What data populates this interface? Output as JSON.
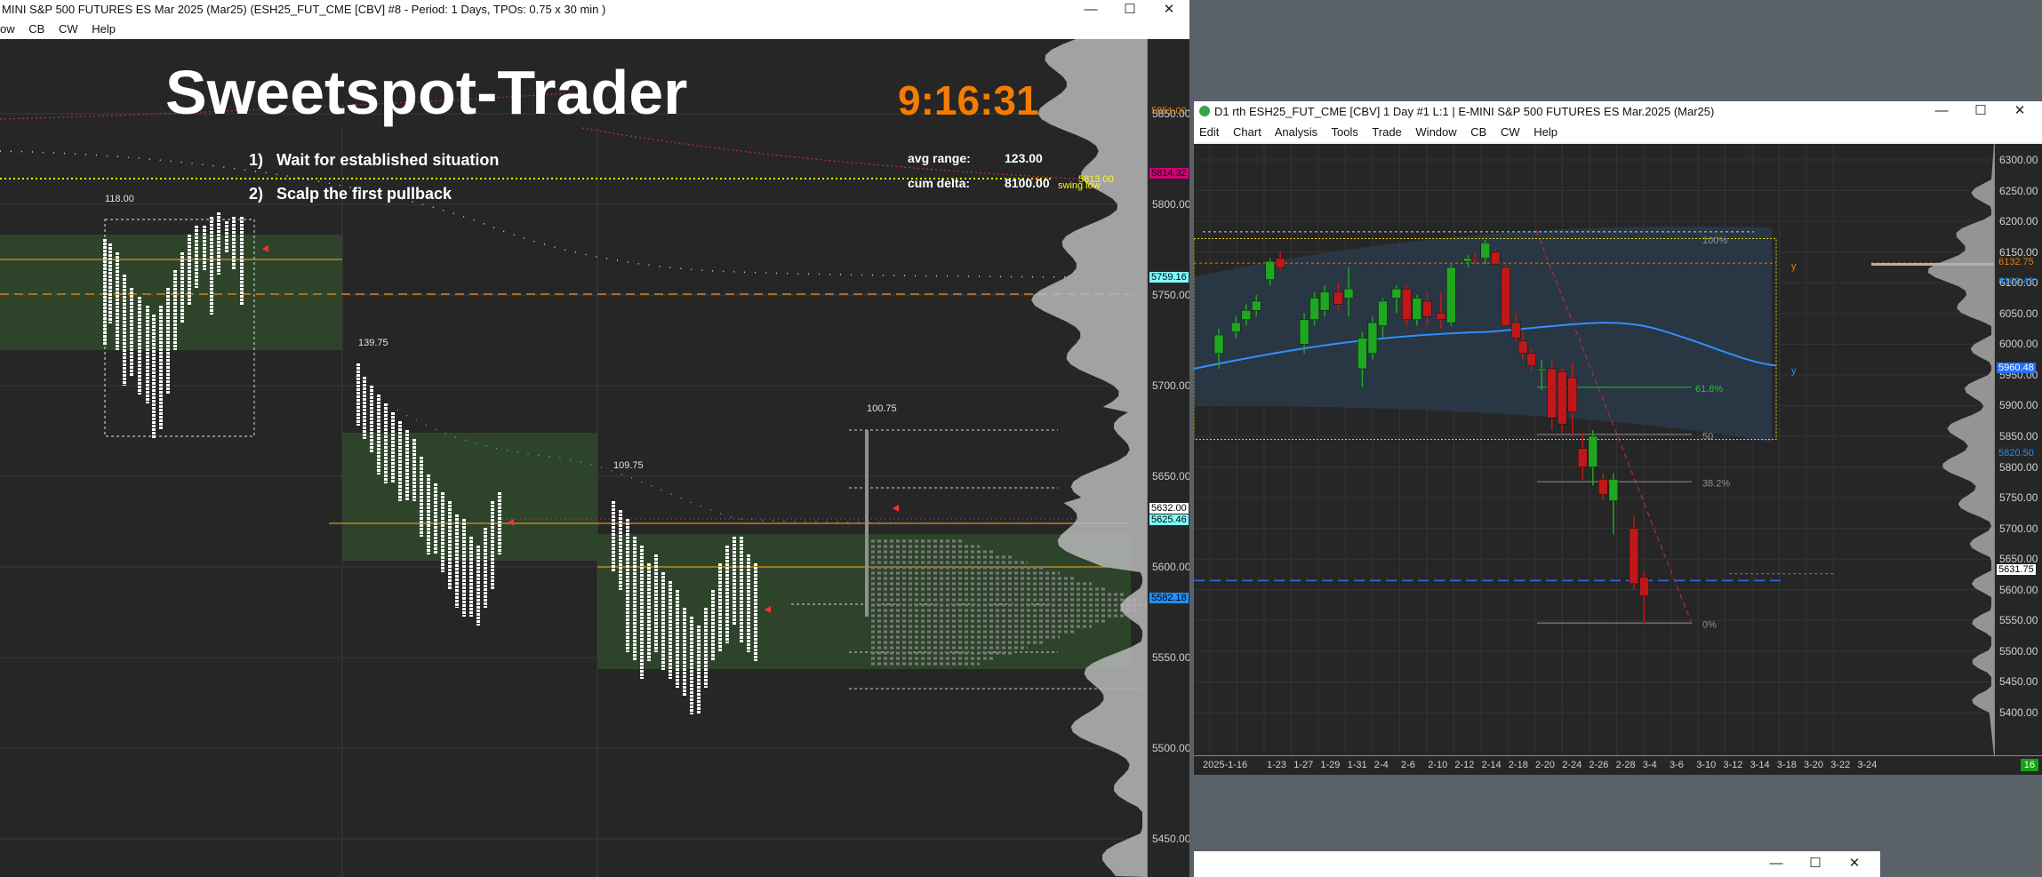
{
  "left_window": {
    "title": "MINI S&P 500 FUTURES ES Mar 2025 (Mar25) (ESH25_FUT_CME [CBV] #8 - Period: 1 Days, TPOs: 0.75 x 30 min  )",
    "menu": [
      "ow",
      "CB",
      "CW",
      "Help"
    ],
    "brand": "Sweetspot-Trader",
    "clock": "9:16:31",
    "rules": [
      "1)   Wait for established situation",
      "2)   Scalp the first pullback"
    ],
    "stats": {
      "avg_range_label": "avg range:",
      "avg_range_value": "123.00",
      "cum_delta_label": "cum delta:",
      "cum_delta_value": "8100.00"
    },
    "range_labels": [
      "118.00",
      "139.75",
      "109.75",
      "100.75"
    ],
    "swing_low": "swing low",
    "price_axis": [
      "5850.00",
      "5800.00",
      "5750.00",
      "5700.00",
      "5650.00",
      "5600.00",
      "5550.00",
      "5500.00",
      "5450.00"
    ],
    "price_tags": [
      {
        "text": "5851.00",
        "color": "#f07800"
      },
      {
        "text": "5813.00",
        "color": "#ffff00"
      },
      {
        "text": "5814.32",
        "color": "#d6007a"
      },
      {
        "text": "5759.16",
        "color": "#80ffff"
      },
      {
        "text": "5632.00",
        "color": "#ffffff"
      },
      {
        "text": "5625.46",
        "color": "#80ffff"
      },
      {
        "text": "5582.18",
        "color": "#1e90ff"
      }
    ]
  },
  "right_window": {
    "title": "D1 rth ESH25_FUT_CME [CBV]  1 Day  #1 L:1 | E-MINI S&P 500 FUTURES ES Mar.2025 (Mar25)",
    "menu": [
      "Edit",
      "Chart",
      "Analysis",
      "Tools",
      "Trade",
      "Window",
      "CB",
      "CW",
      "Help"
    ],
    "price_axis": [
      "6300.00",
      "6250.00",
      "6200.00",
      "6150.00",
      "6100.00",
      "6050.00",
      "6000.00",
      "5950.00",
      "5900.00",
      "5850.00",
      "5800.00",
      "5750.00",
      "5700.00",
      "5650.00",
      "5600.00",
      "5550.00",
      "5500.00",
      "5450.00",
      "5400.00"
    ],
    "price_tags": [
      {
        "text": "6132.75",
        "color": "#f07800"
      },
      {
        "text": "6100.49",
        "color": "#1e90ff"
      },
      {
        "text": "5960.48",
        "color": "#1e90ff"
      },
      {
        "text": "5820.50",
        "color": "#1e90ff"
      },
      {
        "text": "5631.75",
        "color": "#ffffff"
      }
    ],
    "date_axis": [
      "2025-1-16",
      "1-23",
      "1-27",
      "1-29",
      "1-31",
      "2-4",
      "2-6",
      "2-10",
      "2-12",
      "2-14",
      "2-18",
      "2-20",
      "2-24",
      "2-26",
      "2-28",
      "3-4",
      "3-6",
      "3-10",
      "3-12",
      "3-14",
      "3-18",
      "3-20",
      "3-22",
      "3-24"
    ],
    "badge": "16",
    "fib": {
      "f618": "61.8%",
      "f50": "50",
      "f382": "38.2%",
      "f0": "0%",
      "f100": "100%"
    },
    "y_marks": [
      "y",
      "y"
    ]
  },
  "bottom_window": {
    "controls": [
      "—",
      "☐",
      "✕"
    ]
  }
}
